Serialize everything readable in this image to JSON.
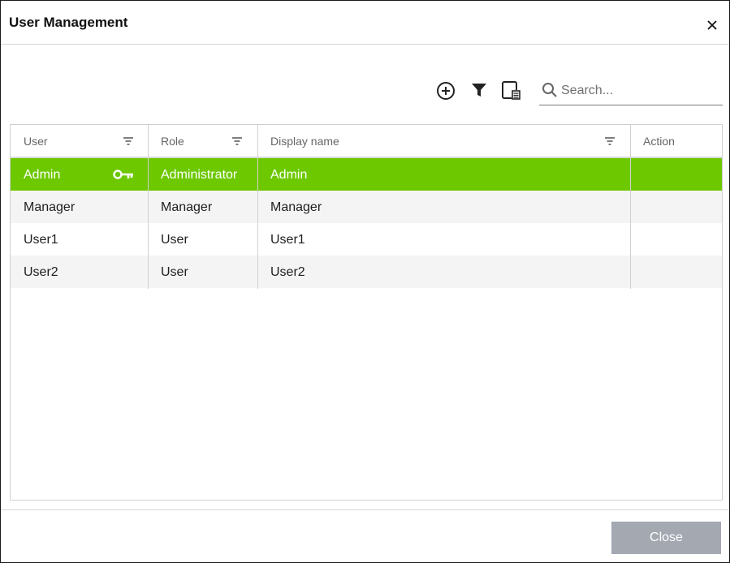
{
  "dialog": {
    "title": "User Management"
  },
  "toolbar": {
    "add_icon": "add-circle-icon",
    "filter_icon": "filter-icon",
    "columns_icon": "column-chooser-icon",
    "search": {
      "icon": "search-icon",
      "placeholder": "Search...",
      "value": ""
    }
  },
  "grid": {
    "columns": [
      {
        "label": "User",
        "filter": true
      },
      {
        "label": "Role",
        "filter": true
      },
      {
        "label": "Display name",
        "filter": true
      },
      {
        "label": "Action",
        "filter": false
      }
    ],
    "rows": [
      {
        "user": "Admin",
        "role": "Administrator",
        "display_name": "Admin",
        "action": "",
        "selected": true,
        "icon": "key-icon"
      },
      {
        "user": "Manager",
        "role": "Manager",
        "display_name": "Manager",
        "action": ""
      },
      {
        "user": "User1",
        "role": "User",
        "display_name": "User1",
        "action": ""
      },
      {
        "user": "User2",
        "role": "User",
        "display_name": "User2",
        "action": ""
      }
    ]
  },
  "footer": {
    "close_label": "Close"
  },
  "colors": {
    "selected_row": "#6dc800",
    "alt_row": "#f4f4f4",
    "close_button": "#a3a8b1"
  }
}
